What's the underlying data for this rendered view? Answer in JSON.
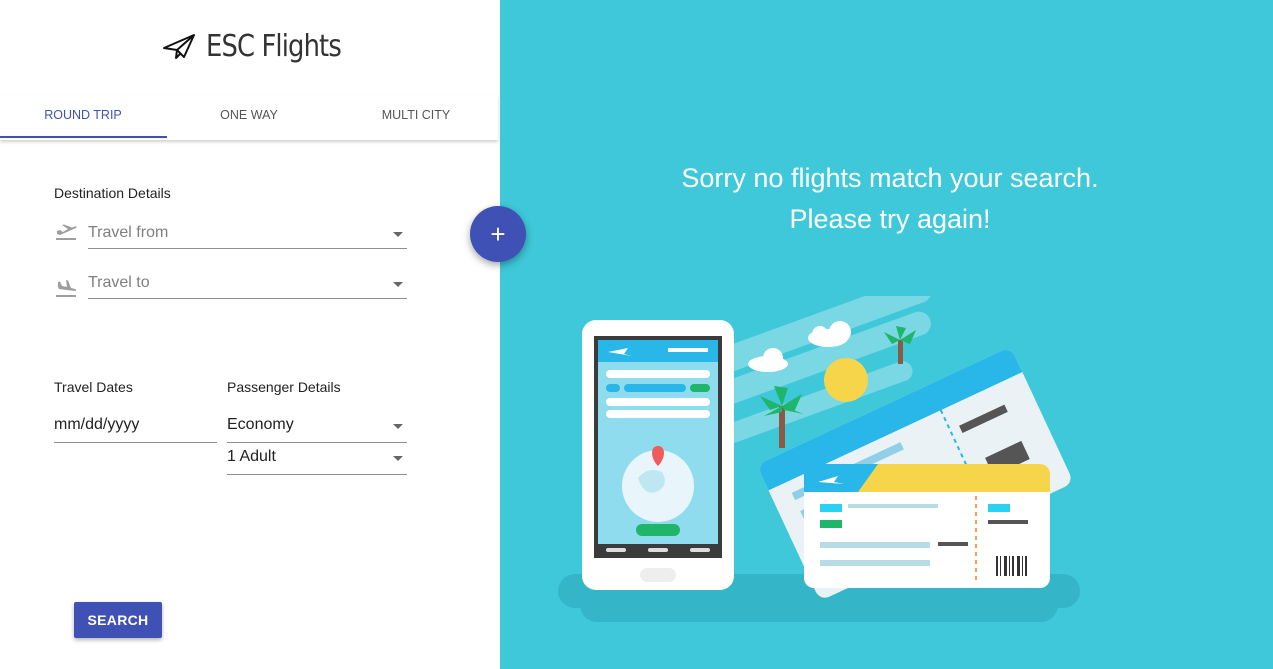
{
  "app": {
    "title": "ESC Flights",
    "logo_icon": "paper-plane-icon"
  },
  "tabs": [
    {
      "label": "ROUND TRIP",
      "active": true
    },
    {
      "label": "ONE WAY",
      "active": false
    },
    {
      "label": "MULTI CITY",
      "active": false
    }
  ],
  "destination": {
    "heading": "Destination Details",
    "from": {
      "placeholder": "Travel from",
      "icon": "flight-takeoff-icon"
    },
    "to": {
      "placeholder": "Travel to",
      "icon": "flight-land-icon"
    }
  },
  "dates": {
    "heading": "Travel Dates",
    "placeholder": "mm/dd/yyyy"
  },
  "passengers": {
    "heading": "Passenger Details",
    "cabin": "Economy",
    "count": "1 Adult"
  },
  "search_label": "SEARCH",
  "fab": {
    "label": "+",
    "icon": "add-icon"
  },
  "message": "Sorry no flights match your search. Please try again!",
  "colors": {
    "primary": "#3f51b5",
    "panel": "#3ec8d9"
  }
}
